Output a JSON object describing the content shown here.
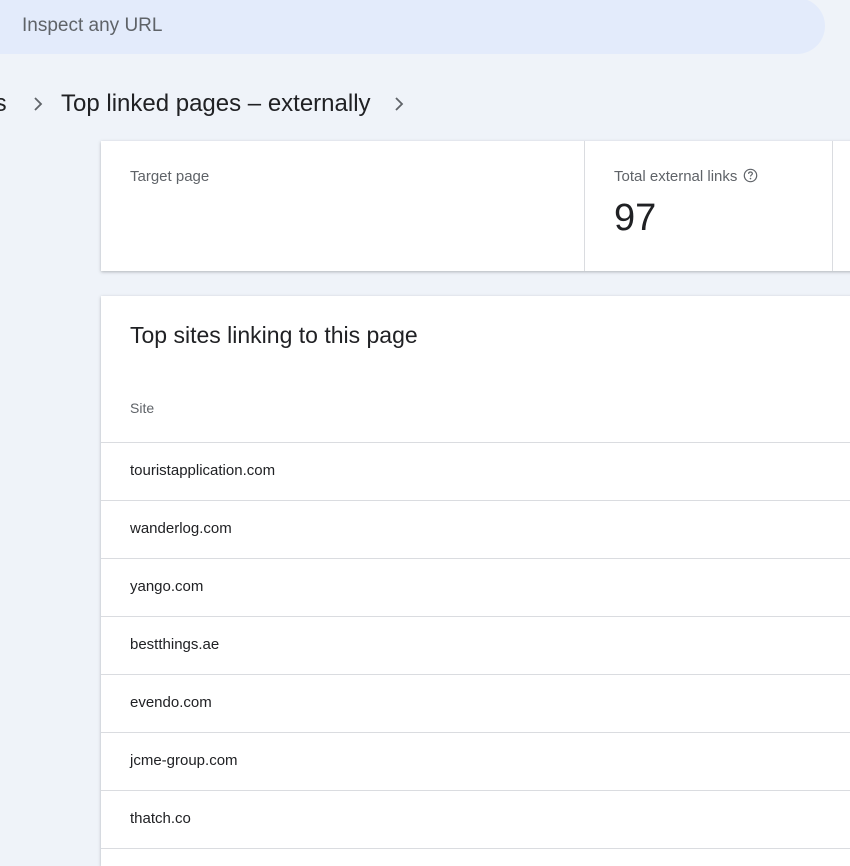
{
  "search": {
    "placeholder": "Inspect any URL"
  },
  "breadcrumb": {
    "previous": "ts",
    "current": "Top linked pages – externally"
  },
  "summary": {
    "target_label": "Target page",
    "total_links_label": "Total external links",
    "total_links_value": "97"
  },
  "sites_table": {
    "title": "Top sites linking to this page",
    "column_header": "Site",
    "rows": [
      "touristapplication.com",
      "wanderlog.com",
      "yango.com",
      "bestthings.ae",
      "evendo.com",
      "jcme-group.com",
      "thatch.co"
    ]
  },
  "colors": {
    "page_background": "#eff3f9",
    "search_background": "#e3ebfb",
    "divider": "#dadce0",
    "secondary_text": "#5f6368"
  }
}
